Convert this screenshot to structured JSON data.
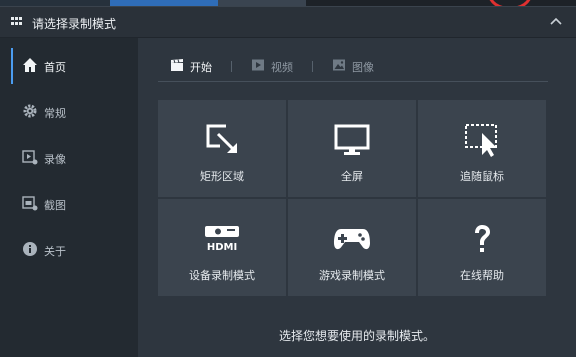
{
  "window": {
    "title": "请选择录制模式"
  },
  "sidebar": {
    "items": [
      {
        "label": "首页",
        "icon": "home-icon",
        "active": true
      },
      {
        "label": "常规",
        "icon": "gear-icon",
        "active": false
      },
      {
        "label": "录像",
        "icon": "video-record-icon",
        "active": false
      },
      {
        "label": "截图",
        "icon": "screenshot-icon",
        "active": false
      },
      {
        "label": "关于",
        "icon": "info-icon",
        "active": false
      }
    ]
  },
  "tabs": [
    {
      "label": "开始",
      "icon": "clapperboard-icon",
      "active": true
    },
    {
      "label": "视频",
      "icon": "play-icon",
      "active": false
    },
    {
      "label": "图像",
      "icon": "image-icon",
      "active": false
    }
  ],
  "tiles": [
    {
      "label": "矩形区域",
      "icon": "rectangle-area-icon"
    },
    {
      "label": "全屏",
      "icon": "monitor-icon"
    },
    {
      "label": "追随鼠标",
      "icon": "follow-mouse-icon"
    },
    {
      "label": "设备录制模式",
      "icon": "hdmi-device-icon"
    },
    {
      "label": "游戏录制模式",
      "icon": "gamepad-icon"
    },
    {
      "label": "在线帮助",
      "icon": "question-icon"
    }
  ],
  "main": {
    "hint": "选择您想要使用的录制模式。"
  },
  "colors": {
    "accent": "#4b9cf0",
    "background": "#2e363f",
    "tile": "#3b444e",
    "sidebar": "#232a31"
  }
}
